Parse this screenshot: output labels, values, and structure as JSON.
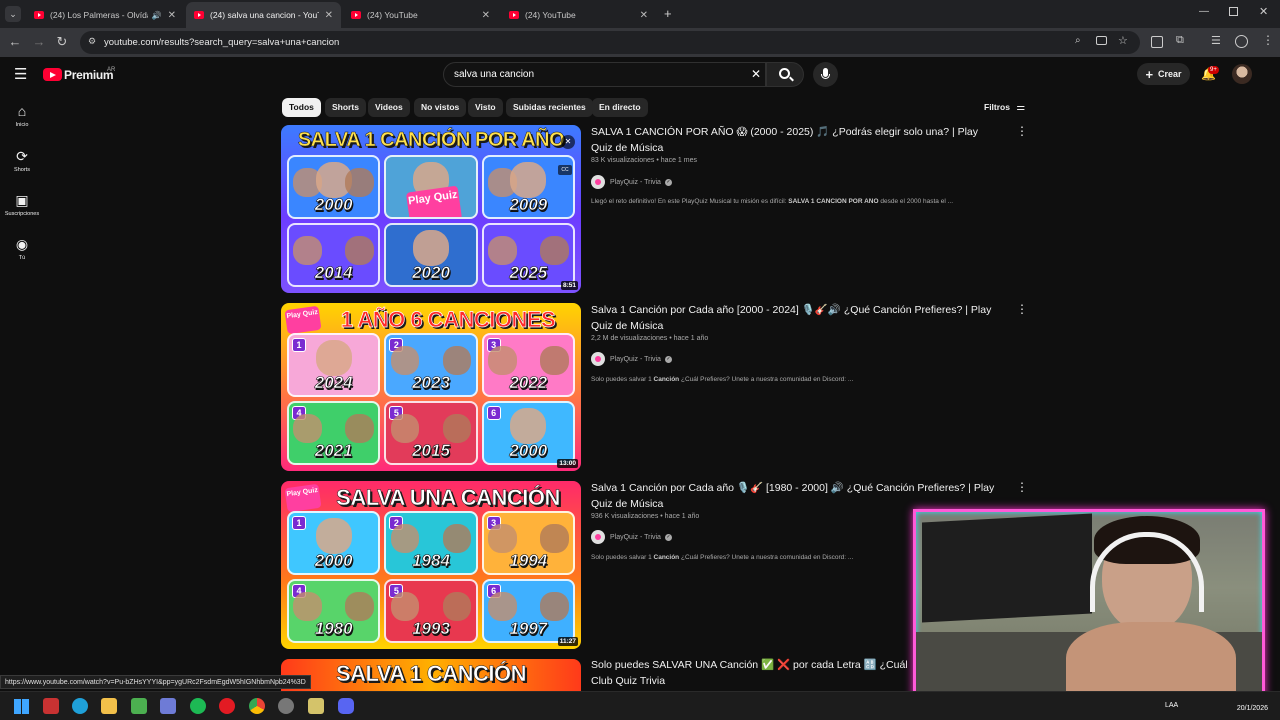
{
  "browser": {
    "tabs": [
      {
        "title": "(24) Los Palmeras - Olvídala",
        "active": false
      },
      {
        "title": "(24) salva una cancion - YouTube",
        "active": true
      },
      {
        "title": "(24) YouTube",
        "active": false
      },
      {
        "title": "(24) YouTube",
        "active": false
      }
    ],
    "url": "youtube.com/results?search_query=salva+una+cancion",
    "status_url": "https://www.youtube.com/watch?v=Pu-bZHsYYYI&pp=ygURc2FsdmEgdW5hIGNhbmNpb24%3D"
  },
  "header": {
    "logo": "Premium",
    "country": "AR",
    "search_value": "salva una cancion",
    "create_label": "Crear",
    "notif_count": "9+"
  },
  "sidebar": {
    "items": [
      {
        "label": "Inicio",
        "icon": "home-icon"
      },
      {
        "label": "Shorts",
        "icon": "shorts-icon"
      },
      {
        "label": "Suscripciones",
        "icon": "subscriptions-icon"
      },
      {
        "label": "Tú",
        "icon": "you-icon"
      }
    ]
  },
  "chips": [
    "Todos",
    "Shorts",
    "Videos",
    "No vistos",
    "Visto",
    "Subidas recientes",
    "En directo"
  ],
  "filters_label": "Filtros",
  "results": [
    {
      "title": "SALVA 1 CANCIÓN POR AÑO 😱 (2000 - 2025) 🎵 ¿Podrás elegir solo una? | Play Quiz de Música",
      "views": "83 K visualizaciones",
      "age": "hace 1 mes",
      "channel": "PlayQuiz - Trivia",
      "desc_pre": "Llegó el reto definitivo! En este PlayQuiz Musical tu misión es difícil: ",
      "desc_bold": "SALVA 1 CANCIÓN POR AÑO",
      "desc_post": " desde el 2000 hasta el ...",
      "thumb_heading": "SALVA 1 CANCIÓN POR AÑO",
      "thumb_years": [
        "2000",
        "",
        "2009",
        "2014",
        "2020",
        "2025"
      ],
      "thumb_logo": "Play Quiz",
      "duration": "8:51"
    },
    {
      "title": "Salva 1 Canción por Cada año [2000 - 2024] 🎙️🎸🔊 ¿Qué Canción Prefieres? | Play Quiz de Música",
      "views": "2,2 M de visualizaciones",
      "age": "hace 1 año",
      "channel": "PlayQuiz - Trivia",
      "desc_pre": "Solo puedes salvar 1 ",
      "desc_bold": "Canción",
      "desc_post": " ¿Cuál Prefieres? Únete a nuestra comunidad en Discord: ...",
      "thumb_heading": "1 AÑO 6 CANCIONES",
      "thumb_years": [
        "2024",
        "2023",
        "2022",
        "2021",
        "2015",
        "2000"
      ],
      "thumb_logo": "Play Quiz",
      "duration": "13:00"
    },
    {
      "title": "Salva 1 Canción por Cada año 🎙️🎸 [1980 - 2000] 🔊 ¿Qué Canción Prefieres? | Play Quiz de Música",
      "views": "936 K visualizaciones",
      "age": "hace 1 año",
      "channel": "PlayQuiz - Trivia",
      "desc_pre": "Solo puedes salvar 1 ",
      "desc_bold": "Canción",
      "desc_post": " ¿Cuál Prefieres? Únete a nuestra comunidad en Discord: ...",
      "thumb_heading": "SALVA UNA CANCIÓN",
      "thumb_years": [
        "2000",
        "1984",
        "1994",
        "1980",
        "1993",
        "1997"
      ],
      "thumb_logo": "Play Quiz",
      "duration": "11:27"
    },
    {
      "title": "Solo puedes SALVAR UNA Canción ✅ ❌ por cada Letra 🔠 ¿Cuál ...",
      "channel_line": "Club Quiz Trivia",
      "thumb_heading": "SALVA 1 CANCIÓN"
    }
  ],
  "taskbar": {
    "lang": "LAA",
    "date": "20/1/2026"
  },
  "colors": {
    "bg": "#0f0f0f",
    "accent": "#ff0033",
    "webcam_border": "#ff5ad8"
  }
}
